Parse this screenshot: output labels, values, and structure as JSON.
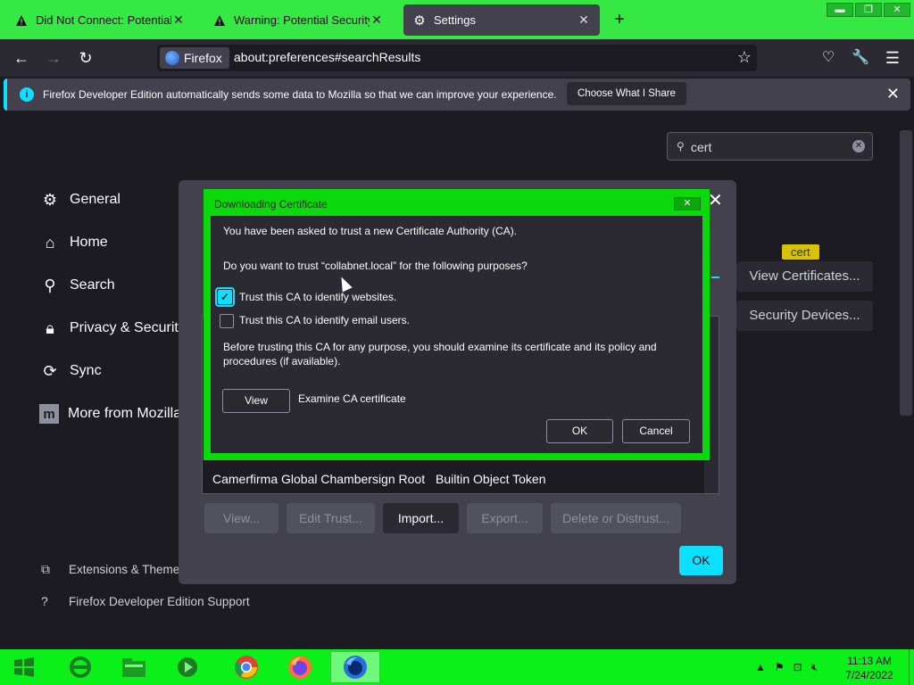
{
  "tabs": [
    {
      "title": "Did Not Connect: Potential Secu",
      "icon": "warning-icon"
    },
    {
      "title": "Warning: Potential Security Risk",
      "icon": "warning-icon"
    },
    {
      "title": "Settings",
      "icon": "gear-icon",
      "active": true
    }
  ],
  "window_controls": {
    "minimize": "▬",
    "restore": "❐",
    "close": "✕"
  },
  "navbar": {
    "identity_label": "Firefox",
    "url": "about:preferences#searchResults"
  },
  "notification": {
    "text": "Firefox Developer Edition automatically sends some data to Mozilla so that we can improve your experience.",
    "button": "Choose What I Share"
  },
  "prefs": {
    "search_value": "cert",
    "categories": [
      {
        "label": "General",
        "icon": "gear-icon"
      },
      {
        "label": "Home",
        "icon": "home-icon"
      },
      {
        "label": "Search",
        "icon": "search-icon"
      },
      {
        "label": "Privacy & Security",
        "icon": "lock-icon"
      },
      {
        "label": "Sync",
        "icon": "sync-icon"
      },
      {
        "label": "More from Mozilla",
        "icon": "mozilla-icon"
      }
    ],
    "footer": [
      {
        "label": "Extensions & Themes",
        "icon": "puzzle-icon"
      },
      {
        "label": "Firefox Developer Edition Support",
        "icon": "help-icon"
      }
    ],
    "view_certificates": "View Certificates...",
    "security_devices": "Security Devices...",
    "tooltip": "cert"
  },
  "cert_manager": {
    "row": {
      "name": "Camerfirma Global Chambersign Root",
      "device": "Builtin Object Token"
    },
    "buttons": [
      "View...",
      "Edit Trust...",
      "Import...",
      "Export...",
      "Delete or Distrust..."
    ],
    "ok": "OK"
  },
  "download_dialog": {
    "title": "Downloading Certificate",
    "close": "✕",
    "intro": "You have been asked to trust a new Certificate Authority (CA).",
    "question": "Do you want to trust “collabnet.local” for the following purposes?",
    "option_websites": "Trust this CA to identify websites.",
    "option_websites_checked": true,
    "option_email": "Trust this CA to identify email users.",
    "option_email_checked": false,
    "warning": "Before trusting this CA for any purpose, you should examine its certificate and its policy and",
    "warning_2": "procedures (if available).",
    "view_button": "View",
    "examine_label": "Examine CA certificate",
    "ok": "OK",
    "cancel": "Cancel"
  },
  "taskbar": {
    "apps": [
      "start-icon",
      "ie-icon",
      "explorer-icon",
      "media-player-icon",
      "chrome-icon",
      "firefox-icon",
      "firefox-dev-icon"
    ],
    "time": "11:13 AM",
    "date": "7/24/2022"
  },
  "colors": {
    "accent": "#0ce0ff",
    "taskbar": "#0cf019",
    "dialog_frame": "#0bd90b"
  }
}
